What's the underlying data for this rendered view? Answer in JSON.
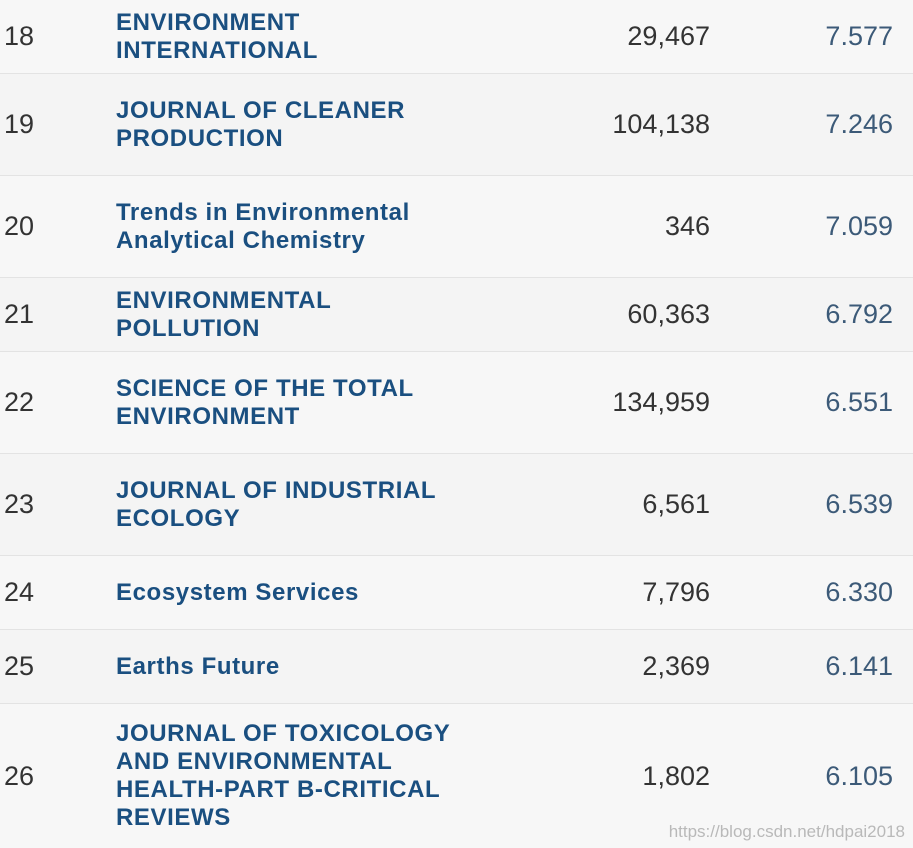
{
  "columns": [
    "rank",
    "journal_title",
    "total_cites",
    "journal_impact_factor"
  ],
  "rows": [
    {
      "rank": "18",
      "title": "ENVIRONMENT\nINTERNATIONAL",
      "cites": "29,467",
      "jif": "7.577"
    },
    {
      "rank": "19",
      "title": "JOURNAL OF CLEANER\nPRODUCTION",
      "cites": "104,138",
      "jif": "7.246"
    },
    {
      "rank": "20",
      "title": "Trends in Environmental\nAnalytical Chemistry",
      "cites": "346",
      "jif": "7.059"
    },
    {
      "rank": "21",
      "title": "ENVIRONMENTAL\nPOLLUTION",
      "cites": "60,363",
      "jif": "6.792"
    },
    {
      "rank": "22",
      "title": "SCIENCE OF THE TOTAL\nENVIRONMENT",
      "cites": "134,959",
      "jif": "6.551"
    },
    {
      "rank": "23",
      "title": "JOURNAL OF INDUSTRIAL\nECOLOGY",
      "cites": "6,561",
      "jif": "6.539"
    },
    {
      "rank": "24",
      "title": "Ecosystem Services",
      "cites": "7,796",
      "jif": "6.330"
    },
    {
      "rank": "25",
      "title": "Earths Future",
      "cites": "2,369",
      "jif": "6.141"
    },
    {
      "rank": "26",
      "title": "JOURNAL OF TOXICOLOGY\nAND ENVIRONMENTAL\nHEALTH-PART B-CRITICAL\nREVIEWS",
      "cites": "1,802",
      "jif": "6.105"
    }
  ],
  "watermark": "https://blog.csdn.net/hdpai2018",
  "colors": {
    "title_link": "#1a4f80",
    "text": "#333333",
    "jif_text": "#3c5a78",
    "row_border": "#e3e3e3",
    "background": "#f7f7f7"
  }
}
